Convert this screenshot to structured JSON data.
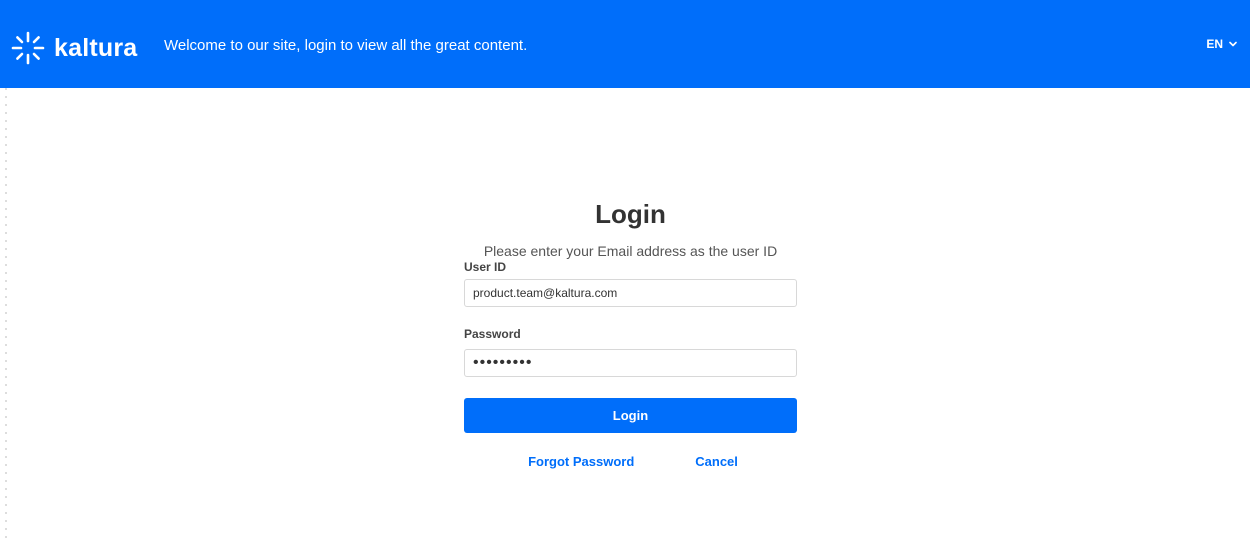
{
  "header": {
    "logo_text": "kaltura",
    "welcome_text": "Welcome to our site, login to view all the great content.",
    "language": "EN",
    "brand_color": "#006efa"
  },
  "login": {
    "title": "Login",
    "hint": "Please enter your Email address as the user ID",
    "user_label": "User ID",
    "user_value": "product.team@kaltura.com",
    "password_label": "Password",
    "password_value": "•••••••••",
    "submit_label": "Login",
    "forgot_label": "Forgot Password",
    "cancel_label": "Cancel"
  },
  "icons": {
    "logo": "kaltura-burst-icon",
    "language_dropdown": "chevron-down-icon"
  }
}
